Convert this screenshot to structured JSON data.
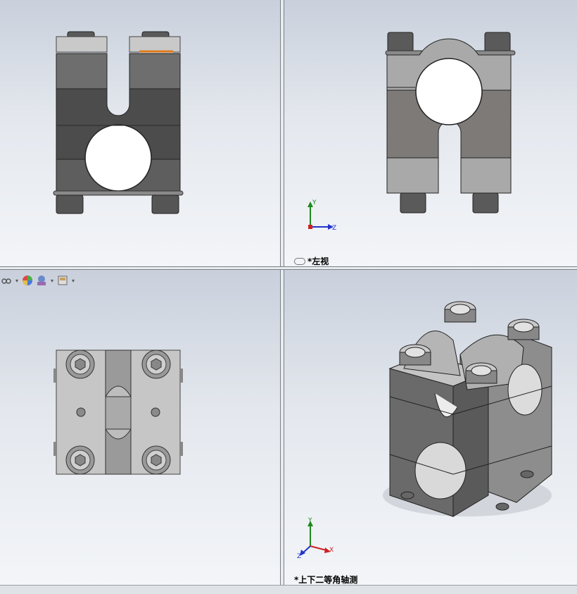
{
  "viewports": {
    "top_left": {
      "name": "front"
    },
    "top_right": {
      "name": "left",
      "label": "*左视"
    },
    "bottom_left": {
      "name": "top"
    },
    "bottom_right": {
      "name": "dimetric",
      "label": "*上下二等角轴测"
    }
  },
  "triad": {
    "y": "Y",
    "z": "Z",
    "x": "X"
  },
  "toolbar": {
    "items": [
      "view-orientation-icon",
      "appearance-icon",
      "scene-icon",
      "display-settings-icon"
    ]
  },
  "colors": {
    "highlight": "#e07a1a",
    "triad_y": "#1b8a1b",
    "triad_z": "#2233cc",
    "triad_x": "#cc2222"
  }
}
